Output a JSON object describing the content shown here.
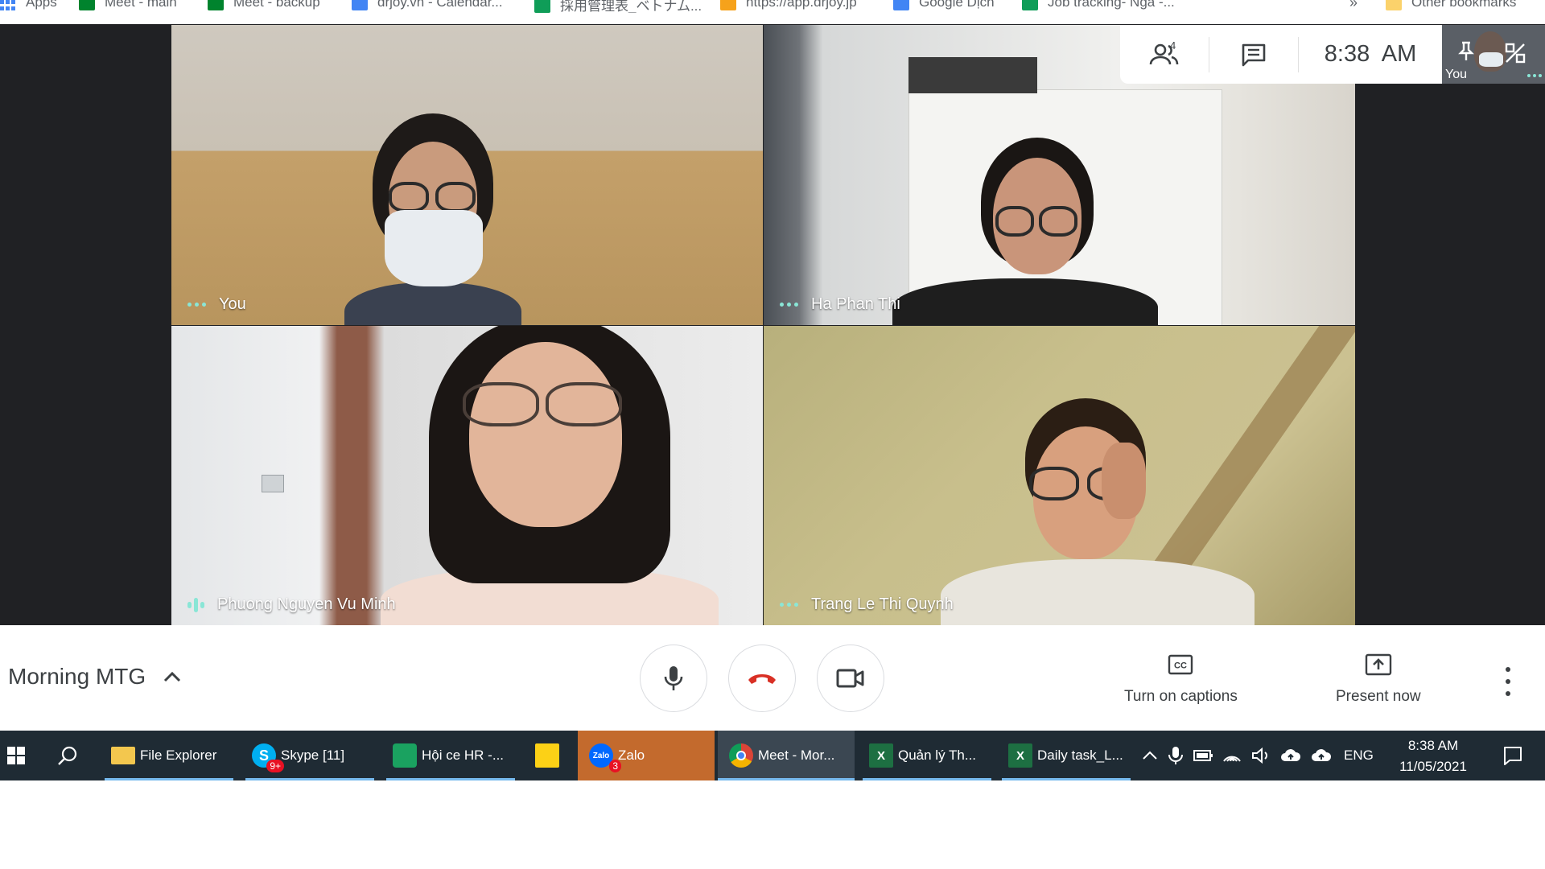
{
  "bookmarks": [
    {
      "label": "Apps",
      "icon": "apps-grid-icon"
    },
    {
      "label": "Meet - main",
      "icon": "meet-icon"
    },
    {
      "label": "Meet - backup",
      "icon": "meet-icon"
    },
    {
      "label": "drjoy.vn - Calendar...",
      "icon": "calendar-icon"
    },
    {
      "label": "採用管理表_ベトナム...",
      "icon": "sheets-icon"
    },
    {
      "label": "https://app.drjoy.jp",
      "icon": "drjoy-icon"
    },
    {
      "label": "Google Dịch",
      "icon": "translate-icon"
    },
    {
      "label": "Job tracking- Nga -...",
      "icon": "sheets-icon"
    }
  ],
  "bookmarks_overflow": "»",
  "other_bookmarks": "Other bookmarks",
  "participants": [
    {
      "name": "You",
      "status": "dots"
    },
    {
      "name": "Ha Phan Thi",
      "status": "dots"
    },
    {
      "name": "Phuong Nguyen Vu Minh",
      "status": "speaking"
    },
    {
      "name": "Trang Le Thi Quynh",
      "status": "dots"
    }
  ],
  "info_panel": {
    "people_count": "4",
    "time": "8:38  AM",
    "self_label": "You"
  },
  "controls": {
    "meeting_title": "Morning MTG",
    "captions_label": "Turn on captions",
    "present_label": "Present now"
  },
  "taskbar": {
    "items": [
      {
        "label": "File Explorer",
        "icon": "folder-icon"
      },
      {
        "label": "Skype [11]",
        "icon": "skype-icon",
        "badge": "9+"
      },
      {
        "label": "Hội ce HR -...",
        "icon": "chat-icon"
      },
      {
        "label": "",
        "icon": "sticky-notes-icon"
      },
      {
        "label": "Zalo",
        "icon": "zalo-icon",
        "badge": "3"
      },
      {
        "label": "Meet - Mor...",
        "icon": "chrome-icon"
      },
      {
        "label": "Quản lý Th...",
        "icon": "excel-icon"
      },
      {
        "label": "Daily task_L...",
        "icon": "excel-icon"
      }
    ],
    "language": "ENG",
    "clock_time": "8:38 AM",
    "clock_date": "11/05/2021"
  },
  "colors": {
    "meet_dark": "#202124",
    "speaking_accent": "#8ae6d6",
    "hangup_red": "#d93025",
    "taskbar": "#1f2b34",
    "zalo_active": "#c36a2d"
  }
}
